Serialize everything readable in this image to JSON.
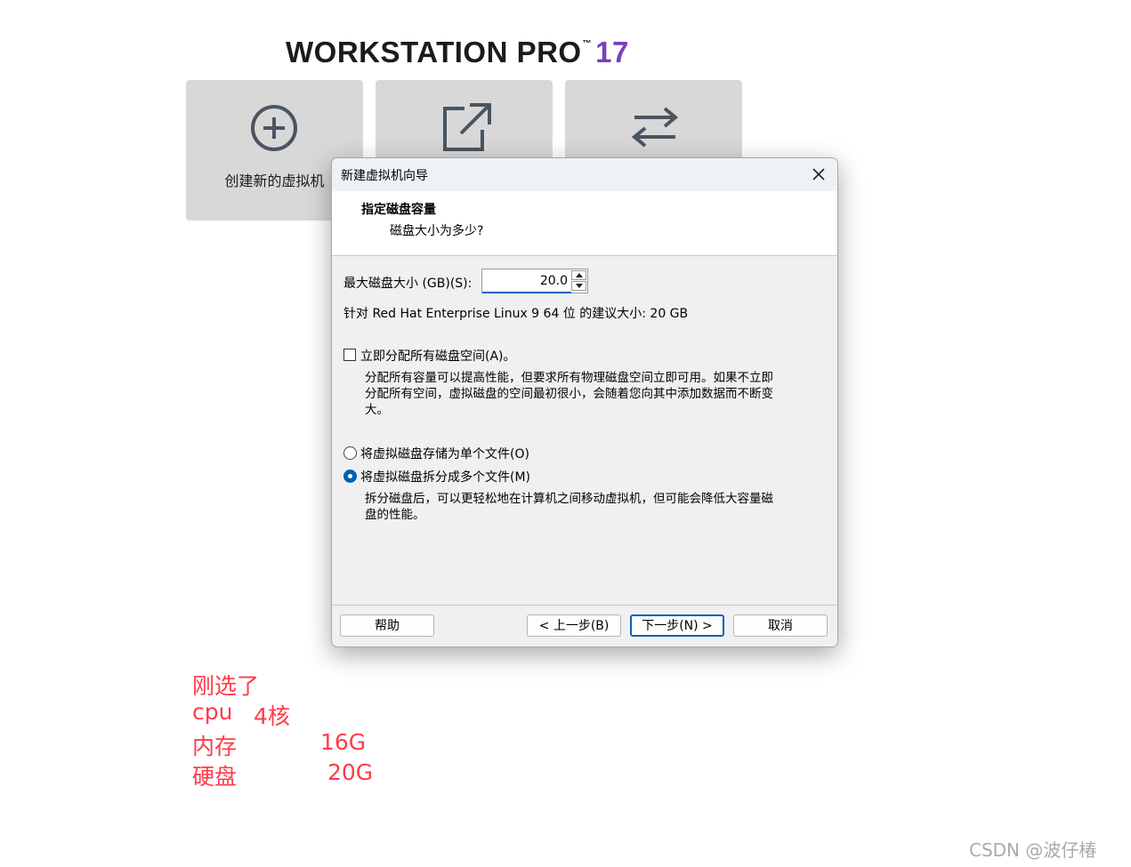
{
  "brand": {
    "name": "WORKSTATION PRO",
    "tm": "™",
    "version": "17"
  },
  "tiles": [
    {
      "label": "创建新的虚拟机",
      "icon": "plus-circle-icon"
    },
    {
      "label": "",
      "icon": "open-external-icon"
    },
    {
      "label": "",
      "icon": "transfer-arrows-icon"
    }
  ],
  "dialog": {
    "title": "新建虚拟机向导",
    "header_title": "指定磁盘容量",
    "header_subtitle": "磁盘大小为多少?",
    "max_size_label": "最大磁盘大小 (GB)(S):",
    "max_size_value": "20.0",
    "recommend": "针对 Red Hat Enterprise Linux 9 64 位 的建议大小: 20 GB",
    "allocate_label": "立即分配所有磁盘空间(A)。",
    "allocate_checked": false,
    "allocate_desc_1": "分配所有容量可以提高性能，但要求所有物理磁盘空间立即可用。如果不立即",
    "allocate_desc_2": "分配所有空间，虚拟磁盘的空间最初很小，会随着您向其中添加数据而不断变",
    "allocate_desc_3": "大。",
    "option_single": "将虚拟磁盘存储为单个文件(O)",
    "option_split": "将虚拟磁盘拆分成多个文件(M)",
    "selected_option": "split",
    "split_desc_1": "拆分磁盘后，可以更轻松地在计算机之间移动虚拟机，但可能会降低大容量磁",
    "split_desc_2": "盘的性能。",
    "buttons": {
      "help": "帮助",
      "back": "< 上一步(B)",
      "next": "下一步(N) >",
      "cancel": "取消"
    }
  },
  "notes": {
    "line1": "刚选了",
    "cpu_label": "cpu",
    "cpu_value": "4核",
    "mem_label": "内存",
    "mem_value": "16G",
    "disk_label": "硬盘",
    "disk_value": "20G"
  },
  "watermark": "CSDN @波仔椿",
  "colors": {
    "accent": "#005fb8",
    "annotation": "#ff3b4a",
    "brand_version": "#7a3fbf"
  }
}
